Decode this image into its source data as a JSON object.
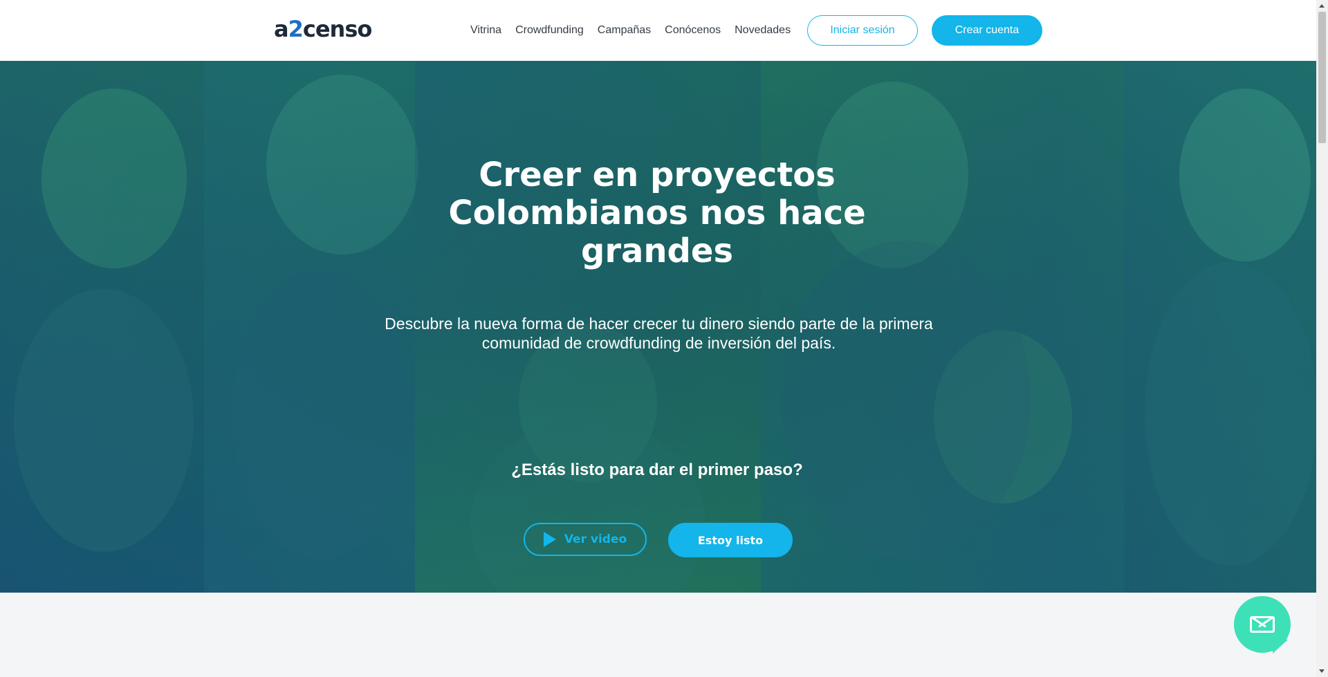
{
  "brand": {
    "logo_prefix": "a",
    "logo_two": "2",
    "logo_suffix": "censo"
  },
  "nav": {
    "items": [
      "Vitrina",
      "Crowdfunding",
      "Campañas",
      "Conócenos",
      "Novedades"
    ],
    "login_label": "Iniciar sesión",
    "register_label": "Crear cuenta"
  },
  "hero": {
    "title": "Creer en proyectos Colombianos nos hace grandes",
    "description": "Descubre la nueva forma de hacer crecer tu dinero siendo parte de la primera comunidad de crowdfunding de inversión del país.",
    "question": "¿Estás listo para dar el primer paso?",
    "video_button": "Ver video",
    "ready_button": "Estoy listo"
  },
  "colors": {
    "accent": "#13b5ea",
    "chat": "#3ee0b8",
    "logo_two": "#1c6fc4",
    "hero_overlay": "#1e6a6e"
  },
  "icons": {
    "video": "play-icon",
    "chat": "mail-icon"
  }
}
